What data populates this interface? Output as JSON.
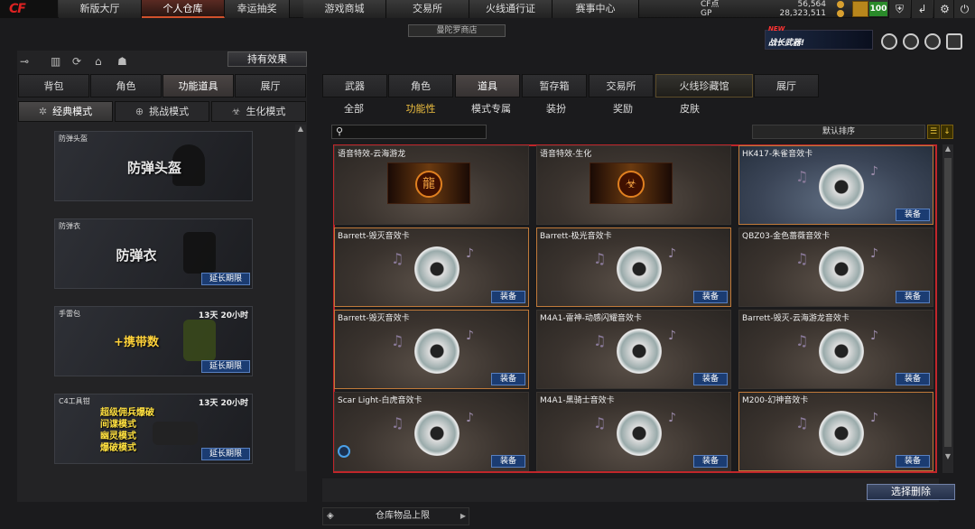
{
  "topbar": {
    "logo": "CF",
    "nav": [
      "新版大厅",
      "个人仓库",
      "幸运抽奖",
      "游戏商城",
      "交易所",
      "火线通行证",
      "赛事中心"
    ],
    "active_index": 1,
    "cf_label": "CF点",
    "cf_value": "56,564",
    "gp_label": "GP",
    "gp_value": "28,323,511",
    "level": "100"
  },
  "shop_tag": "曼陀罗商店",
  "ad": {
    "new": "NEW",
    "title": "战长武器!"
  },
  "left": {
    "effect_button": "持有效果",
    "tabs": [
      "背包",
      "角色",
      "功能道具",
      "展厅"
    ],
    "active_tab": 2,
    "modes": [
      "经典模式",
      "挑战模式",
      "生化模式"
    ],
    "active_mode": 0,
    "cards": [
      {
        "title": "防弹头盔",
        "art": "防弹头盔",
        "duration": "",
        "extend": ""
      },
      {
        "title": "防弹衣",
        "art": "防弹衣",
        "duration": "",
        "extend": "延长期限"
      },
      {
        "title": "手雷包",
        "art": "+携带数",
        "duration": "13天 20小时",
        "extend": "延长期限"
      },
      {
        "title": "C4工具钳",
        "art": "",
        "duration": "13天 20小时",
        "extend": "延长期限",
        "modes": [
          "超级佣兵爆破",
          "间谍模式",
          "幽灵模式",
          "爆破模式"
        ]
      }
    ]
  },
  "right": {
    "tabs": [
      "武器",
      "角色",
      "道具",
      "暂存箱",
      "交易所",
      "火线珍藏馆",
      "展厅"
    ],
    "active_tab": 2,
    "subtabs": [
      "全部",
      "功能性",
      "模式专属",
      "装扮",
      "奖励",
      "皮肤"
    ],
    "active_subtab": 1,
    "sort_label": "默认排序",
    "equip_label": "装备",
    "items": [
      {
        "name": "语音特效-云海游龙",
        "kind": "voice",
        "equip": false
      },
      {
        "name": "语音特效-生化",
        "kind": "voice",
        "equip": false
      },
      {
        "name": "HK417-朱雀音效卡",
        "kind": "disc-blue",
        "equip": true
      },
      {
        "name": "Barrett-毁灭音效卡",
        "kind": "disc",
        "equip": true
      },
      {
        "name": "Barrett-极光音效卡",
        "kind": "disc",
        "equip": true
      },
      {
        "name": "QBZ03-金色蔷薇音效卡",
        "kind": "disc",
        "equip": true
      },
      {
        "name": "Barrett-毁灭音效卡",
        "kind": "disc",
        "equip": true
      },
      {
        "name": "M4A1-雷神-动感闪耀音效卡",
        "kind": "disc",
        "equip": true
      },
      {
        "name": "Barrett-毁灭-云海游龙音效卡",
        "kind": "disc",
        "equip": true
      },
      {
        "name": "Scar Light-白虎音效卡",
        "kind": "disc",
        "equip": true
      },
      {
        "name": "M4A1-黑骑士音效卡",
        "kind": "disc",
        "equip": true
      },
      {
        "name": "M200-幻神音效卡",
        "kind": "disc",
        "equip": true
      }
    ],
    "storage_label": "仓库物品上限",
    "delete_button": "选择删除"
  },
  "colors": {
    "accent": "#d0512c",
    "highlight_border": "#c0262a",
    "equip_button": "#1b3c72",
    "active_subtab": "#f0c040"
  }
}
